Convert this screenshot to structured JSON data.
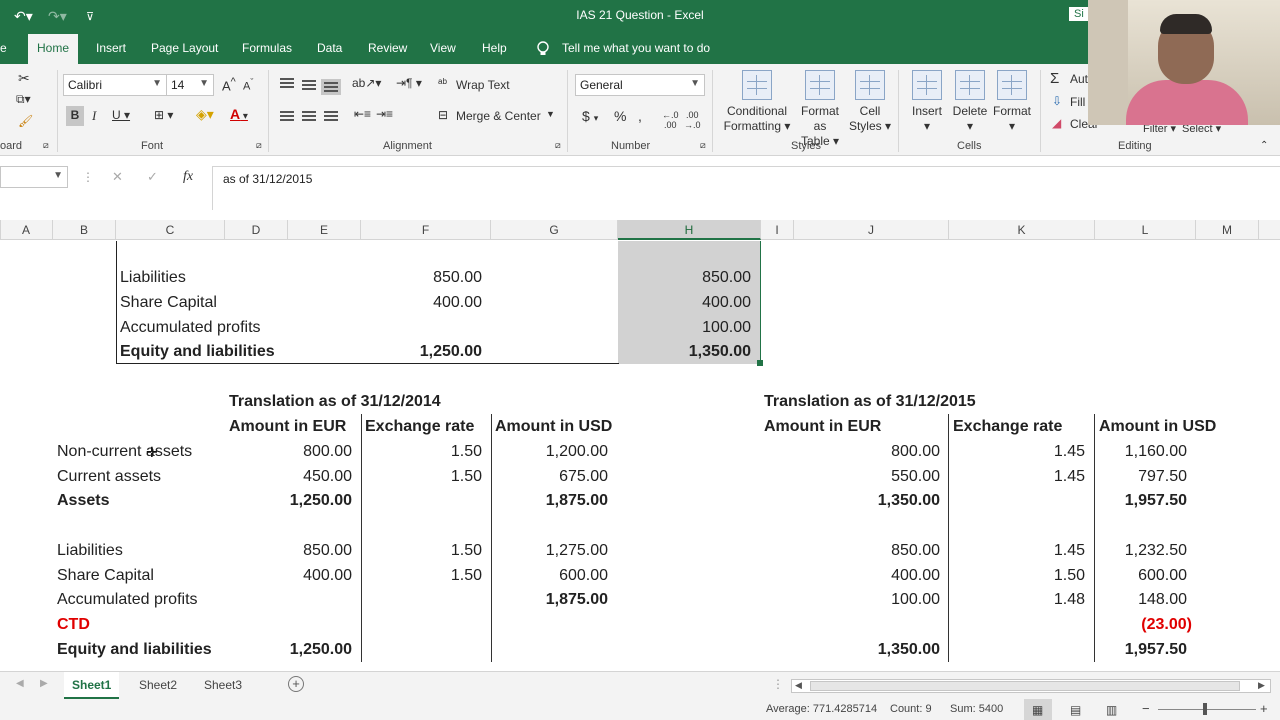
{
  "title_bar": {
    "title": "IAS 21 Question - Excel",
    "undo_icon": "undo-icon",
    "redo_icon": "redo-icon",
    "signin_label": "Si"
  },
  "ribbon_tabs": [
    {
      "label": "e"
    },
    {
      "label": "Home"
    },
    {
      "label": "Insert"
    },
    {
      "label": "Page Layout"
    },
    {
      "label": "Formulas"
    },
    {
      "label": "Data"
    },
    {
      "label": "Review"
    },
    {
      "label": "View"
    },
    {
      "label": "Help"
    }
  ],
  "tell_me": "Tell me what you want to do",
  "ribbon": {
    "font_name": "Calibri",
    "font_size": "14",
    "wrap_text": "Wrap Text",
    "merge_center": "Merge & Center",
    "number_format": "General",
    "conditional_formatting": [
      "Conditional",
      "Formatting"
    ],
    "format_as_table": [
      "Format as",
      "Table"
    ],
    "cell_styles": [
      "Cell",
      "Styles"
    ],
    "insert": "Insert",
    "delete": "Delete",
    "format": "Format",
    "autosum": "Aut",
    "fill": "Fill",
    "clear": "Clear",
    "filter": "Filter",
    "select": "Select",
    "groups": {
      "clipboard": "oard",
      "font": "Font",
      "alignment": "Alignment",
      "number": "Number",
      "styles": "Styles",
      "cells": "Cells",
      "editing": "Editing"
    }
  },
  "formula_bar": {
    "content": "as of 31/12/2015"
  },
  "columns": [
    "A",
    "B",
    "C",
    "D",
    "E",
    "F",
    "G",
    "H",
    "I",
    "J",
    "K",
    "L",
    "M"
  ],
  "sheet": {
    "top_block": [
      {
        "label": "Liabilities",
        "f": "850.00",
        "h": "850.00"
      },
      {
        "label": "Share Capital",
        "f": "400.00",
        "h": "400.00"
      },
      {
        "label": "Accumulated profits",
        "f": "",
        "h": "100.00"
      },
      {
        "label": "Equity and liabilities",
        "f": "1,250.00",
        "h": "1,350.00"
      }
    ],
    "title_2014": "Translation as of 31/12/2014",
    "title_2015": "Translation as of 31/12/2015",
    "col_eur": "Amount in EUR",
    "col_rate": "Exchange rate",
    "col_usd": "Amount in USD",
    "rows": [
      {
        "label": "Non-current assets",
        "eur14": "800.00",
        "rate14": "1.50",
        "usd14": "1,200.00",
        "eur15": "800.00",
        "rate15": "1.45",
        "usd15": "1,160.00"
      },
      {
        "label": "Current assets",
        "eur14": "450.00",
        "rate14": "1.50",
        "usd14": "675.00",
        "eur15": "550.00",
        "rate15": "1.45",
        "usd15": "797.50"
      },
      {
        "label": "Assets",
        "eur14": "1,250.00",
        "rate14": "",
        "usd14": "1,875.00",
        "eur15": "1,350.00",
        "rate15": "",
        "usd15": "1,957.50"
      },
      {
        "label": "Liabilities",
        "eur14": "850.00",
        "rate14": "1.50",
        "usd14": "1,275.00",
        "eur15": "850.00",
        "rate15": "1.45",
        "usd15": "1,232.50"
      },
      {
        "label": "Share Capital",
        "eur14": "400.00",
        "rate14": "1.50",
        "usd14": "600.00",
        "eur15": "400.00",
        "rate15": "1.50",
        "usd15": "600.00"
      },
      {
        "label": "Accumulated profits",
        "eur14": "",
        "rate14": "",
        "usd14": "1,875.00",
        "eur15": "100.00",
        "rate15": "1.48",
        "usd15": "148.00"
      },
      {
        "label": "CTD",
        "eur14": "",
        "rate14": "",
        "usd14": "",
        "eur15": "",
        "rate15": "",
        "usd15": "(23.00)"
      },
      {
        "label": "Equity and liabilities",
        "eur14": "1,250.00",
        "rate14": "",
        "usd14": "",
        "eur15": "1,350.00",
        "rate15": "",
        "usd15": "1,957.50"
      }
    ]
  },
  "sheet_tabs": [
    {
      "label": "Sheet1"
    },
    {
      "label": "Sheet2"
    },
    {
      "label": "Sheet3"
    }
  ],
  "status_bar": {
    "average": "Average: 771.4285714",
    "count": "Count: 9",
    "sum": "Sum: 5400"
  },
  "colors": {
    "excel_green": "#217346",
    "negative_red": "#e00000"
  }
}
